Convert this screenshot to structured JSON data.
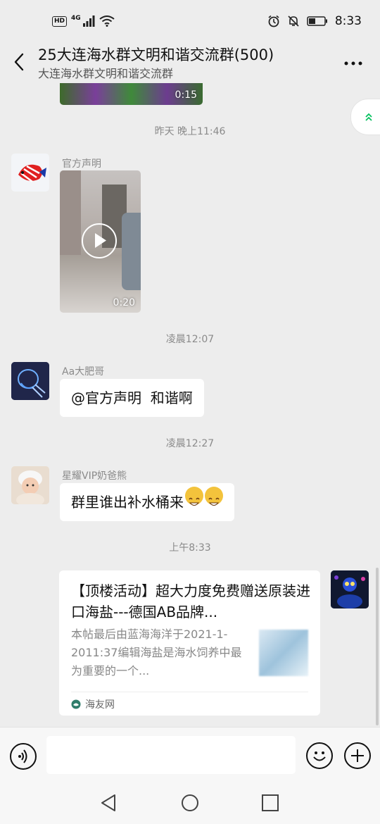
{
  "status_bar": {
    "network": "4G",
    "hd": "HD",
    "time": "8:33"
  },
  "header": {
    "title": "25大连海水群文明和谐交流群(500)",
    "subtitle": "大连海水群文明和谐交流群"
  },
  "chat": {
    "top_video_duration": "0:15",
    "messages": [
      {
        "timestamp": "昨天 晚上11:46",
        "sender": "官方声明",
        "type": "video",
        "duration": "0:20"
      },
      {
        "timestamp": "凌晨12:07",
        "sender": "Aa大肥哥",
        "type": "text",
        "text": "@官方声明  和谐啊"
      },
      {
        "timestamp": "凌晨12:27",
        "sender": "星耀VIP奶爸熊",
        "type": "text",
        "text": "群里谁出补水桶来"
      },
      {
        "timestamp": "上午8:33",
        "sender": "",
        "type": "link_card",
        "card": {
          "title": "【顶楼活动】超大力度免费赠送原装进口海盐---德国AB品牌...",
          "description": "本帖最后由蓝海海洋于2021-1-2011:37编辑海盐是海水饲养中最为重要的一个...",
          "source": "海友网"
        }
      }
    ]
  },
  "colors": {
    "background": "#ededed",
    "bubble": "#ffffff",
    "accent_green": "#07c160"
  }
}
